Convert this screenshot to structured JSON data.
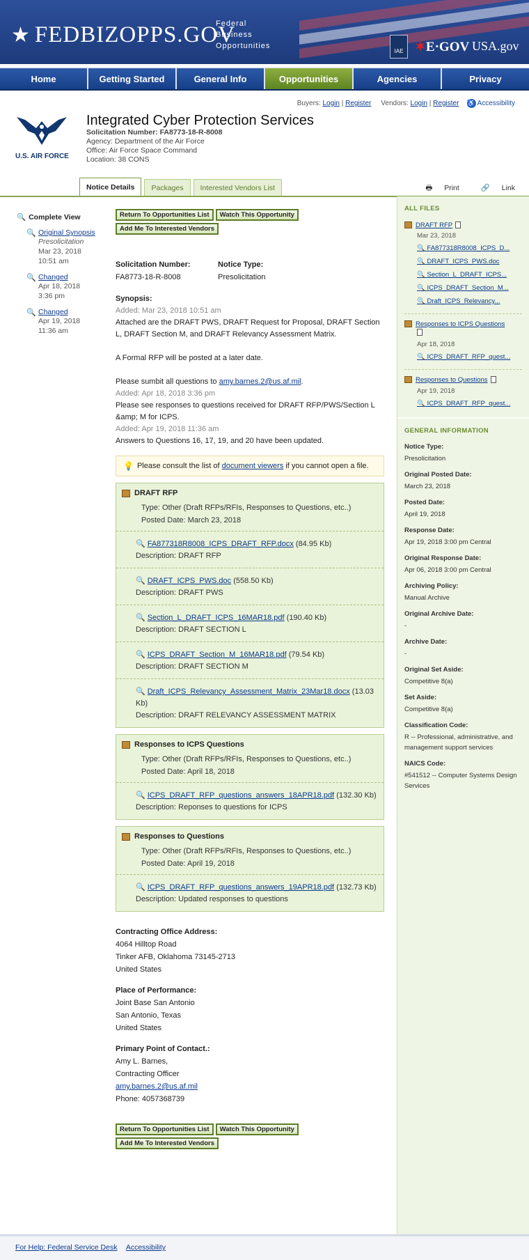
{
  "header": {
    "logo_text": "FEDBIZOPPS.GOV",
    "logo_sub": [
      "Federal",
      "Business",
      "Opportunities"
    ],
    "iae_label": "IAE",
    "egov_label": "E·GOV",
    "usagov_label": "USA.gov"
  },
  "nav": {
    "items": [
      "Home",
      "Getting Started",
      "General Info",
      "Opportunities",
      "Agencies",
      "Privacy"
    ],
    "active": "Opportunities"
  },
  "loginbar": {
    "buyers": "Buyers:",
    "vendors": "Vendors:",
    "login": "Login",
    "register": "Register",
    "accessibility": "Accessibility"
  },
  "agency_logo": {
    "text": "U.S. AIR FORCE"
  },
  "notice": {
    "title": "Integrated Cyber Protection Services",
    "solicitation_label": "Solicitation Number: FA8773-18-R-8008",
    "agency": "Agency: Department of the Air Force",
    "office": "Office: Air Force Space Command",
    "location": "Location: 38 CONS"
  },
  "tabs": [
    "Notice Details",
    "Packages",
    "Interested Vendors List"
  ],
  "tools": {
    "print": "Print",
    "link": "Link"
  },
  "history": {
    "complete_view": "Complete View",
    "items": [
      {
        "link": "Original Synopsis",
        "type": "Presolicitation",
        "date": "Mar 23, 2018",
        "time": "10:51 am"
      },
      {
        "link": "Changed",
        "type": "",
        "date": "Apr 18, 2018",
        "time": "3:36 pm"
      },
      {
        "link": "Changed",
        "type": "",
        "date": "Apr 19, 2018",
        "time": "11:36 am"
      }
    ]
  },
  "buttons": {
    "return": "Return To Opportunities List",
    "watch": "Watch This Opportunity",
    "add": "Add Me To Interested Vendors"
  },
  "details": {
    "sol_label": "Solicitation Number:",
    "sol_value": "FA8773-18-R-8008",
    "type_label": "Notice Type:",
    "type_value": "Presolicitation",
    "synopsis_label": "Synopsis:",
    "added1": "Added: Mar 23, 2018 10:51 am",
    "text1": "Attached are the DRAFT PWS, DRAFT Request for Proposal, DRAFT Section L, DRAFT Section M, and DRAFT Relevancy Assessment Matrix.",
    "text2": "A Formal RFP will be posted at a later date.",
    "text3_pre": "Please sumbit all questions to",
    "text3_email": "amy.barnes.2@us.af.mil",
    "added2": "Added: Apr 18, 2018 3:36 pm",
    "text4": "Please see responses to questions received for DRAFT RFP/PWS/Section L &amp; M for ICPS.",
    "added3": "Added: Apr 19, 2018 11:36 am",
    "text5": "Answers to Questions 16, 17, 19, and 20 have been updated."
  },
  "viewers": {
    "pre": "Please consult the list of",
    "link": "document viewers",
    "post": "if you cannot open a file."
  },
  "packages": [
    {
      "title": "DRAFT RFP",
      "type": "Type: Other (Draft RFPs/RFIs, Responses to Questions, etc..)",
      "posted": "Posted Date: March 23, 2018",
      "files": [
        {
          "name": "FA877318R8008_ICPS_DRAFT_RFP.docx",
          "size": "(84.95 Kb)",
          "desc": "DRAFT RFP"
        },
        {
          "name": "DRAFT_ICPS_PWS.doc",
          "size": "(558.50 Kb)",
          "desc": "DRAFT PWS"
        },
        {
          "name": "Section_L_DRAFT_ICPS_16MAR18.pdf",
          "size": "(190.40 Kb)",
          "desc": "DRAFT SECTION L"
        },
        {
          "name": "ICPS_DRAFT_Section_M_16MAR18.pdf",
          "size": "(79.54 Kb)",
          "desc": "DRAFT SECTION M"
        },
        {
          "name": "Draft_ICPS_Relevancy_Assessment_Matrix_23Mar18.docx",
          "size": "(13.03 Kb)",
          "desc": "DRAFT RELEVANCY ASSESSMENT MATRIX"
        }
      ]
    },
    {
      "title": "Responses to ICPS Questions",
      "type": "Type: Other (Draft RFPs/RFIs, Responses to Questions, etc..)",
      "posted": "Posted Date: April 18, 2018",
      "files": [
        {
          "name": "ICPS_DRAFT_RFP_questions_answers_18APR18.pdf",
          "size": "(132.30 Kb)",
          "desc": "Reponses to questions for ICPS"
        }
      ]
    },
    {
      "title": "Responses to Questions",
      "type": "Type: Other (Draft RFPs/RFIs, Responses to Questions, etc..)",
      "posted": "Posted Date: April 19, 2018",
      "files": [
        {
          "name": "ICPS_DRAFT_RFP_questions_answers_19APR18.pdf",
          "size": "(132.73 Kb)",
          "desc": "Updated responses to questions"
        }
      ]
    }
  ],
  "desc_label": "Description:",
  "office_address": {
    "label": "Contracting Office Address:",
    "lines": [
      "4064 Hilltop Road",
      "Tinker AFB, Oklahoma 73145-2713",
      "United States"
    ]
  },
  "place_of_performance": {
    "label": "Place of Performance:",
    "lines": [
      "Joint Base San Antonio",
      "San Antonio, Texas",
      "United States"
    ]
  },
  "contact": {
    "label": "Primary Point of Contact.:",
    "name": "Amy L. Barnes,",
    "title": "Contracting Officer",
    "email": "amy.barnes.2@us.af.mil",
    "phone": "Phone: 4057368739"
  },
  "sidebar": {
    "all_files_head": "ALL FILES",
    "groups": [
      {
        "title": "DRAFT RFP",
        "date": "Mar 23, 2018",
        "files": [
          "FA877318R8008_ICPS_D...",
          "DRAFT_ICPS_PWS.doc",
          "Section_L_DRAFT_ICPS...",
          "ICPS_DRAFT_Section_M...",
          "Draft_ICPS_Relevancy..."
        ]
      },
      {
        "title": "Responses to ICPS Questions",
        "date": "Apr 18, 2018",
        "files": [
          "ICPS_DRAFT_RFP_quest..."
        ]
      },
      {
        "title": "Responses to Questions",
        "date": "Apr 19, 2018",
        "files": [
          "ICPS_DRAFT_RFP_quest..."
        ]
      }
    ],
    "general_head": "GENERAL INFORMATION",
    "info": [
      {
        "label": "Notice Type:",
        "value": "Presolicitation"
      },
      {
        "label": "Original Posted Date:",
        "value": "March 23, 2018"
      },
      {
        "label": "Posted Date:",
        "value": "April 19, 2018"
      },
      {
        "label": "Response Date:",
        "value": "Apr 19, 2018 3:00 pm Central"
      },
      {
        "label": "Original Response Date:",
        "value": "Apr 06, 2018 3:00 pm Central"
      },
      {
        "label": "Archiving Policy:",
        "value": "Manual Archive"
      },
      {
        "label": "Original Archive Date:",
        "value": "-"
      },
      {
        "label": "Archive Date:",
        "value": "-"
      },
      {
        "label": "Original Set Aside:",
        "value": "Competitive 8(a)"
      },
      {
        "label": "Set Aside:",
        "value": "Competitive 8(a)"
      },
      {
        "label": "Classification Code:",
        "value": "R -- Professional, administrative, and management support services"
      },
      {
        "label": "NAICS Code:",
        "value": "#541512 -- Computer Systems Design Services"
      }
    ]
  },
  "footer": {
    "help": "For Help: Federal Service Desk",
    "accessibility": "Accessibility"
  }
}
